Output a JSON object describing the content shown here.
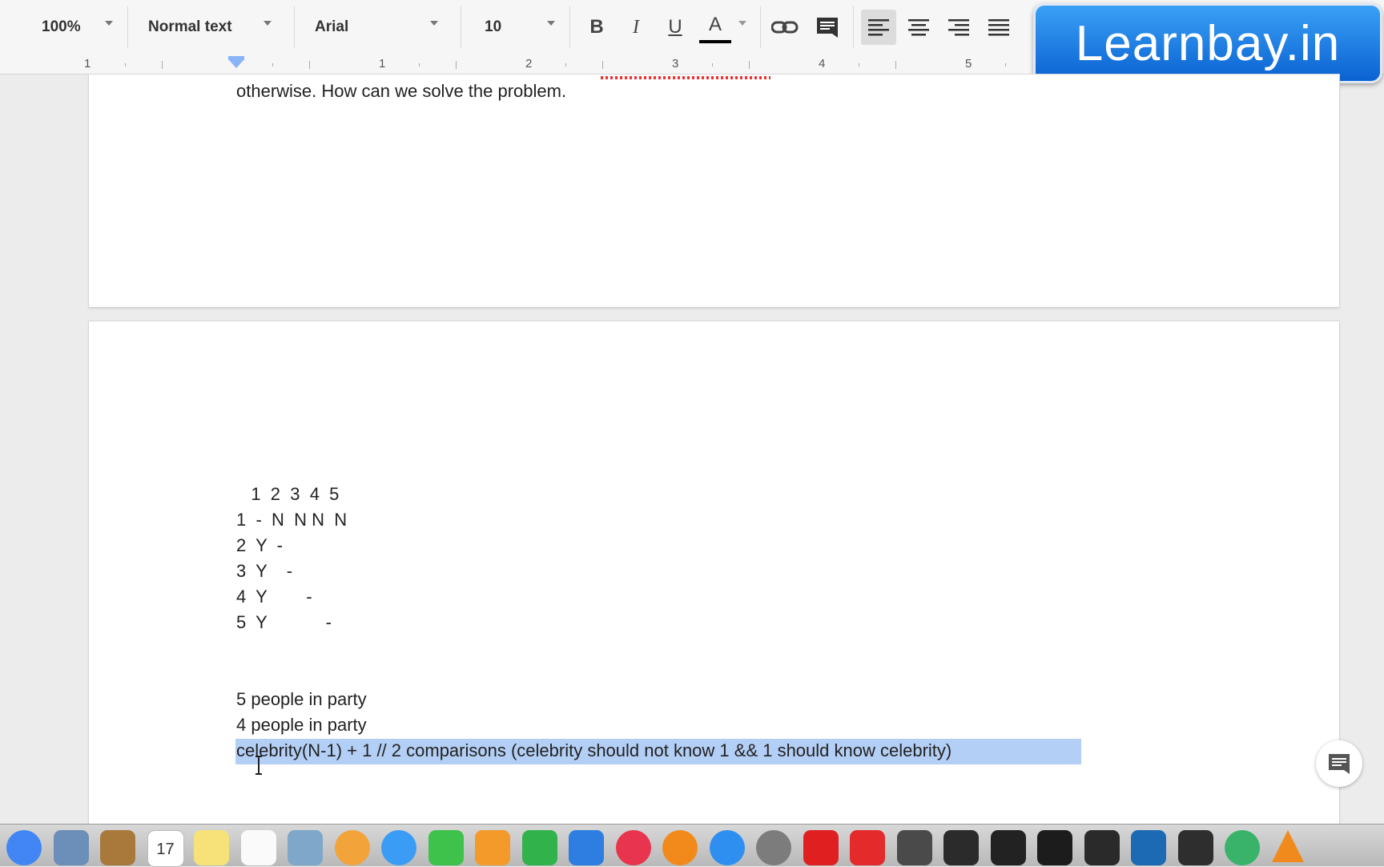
{
  "toolbar": {
    "zoom": "100%",
    "style": "Normal text",
    "font": "Arial",
    "size": "10",
    "bold": "B",
    "italic": "I",
    "underline": "U",
    "text_color": "A"
  },
  "ruler": {
    "labels": [
      "1",
      "1",
      "2",
      "3",
      "4",
      "5"
    ]
  },
  "logo": {
    "text": "Learnbay.in"
  },
  "page1": {
    "line": "otherwise. How can we solve the problem."
  },
  "page2": {
    "matrix": [
      "   1  2  3  4  5",
      "1  -  N  N N  N",
      "2  Y  -",
      "3  Y    -",
      "4  Y        -",
      "5  Y            -"
    ],
    "notes": [
      "5 people in party",
      "4 people in party",
      "celebrity(N-1) + 1 // 2 comparisons (celebrity should not know 1 && 1 should know celebrity)"
    ]
  },
  "dock": {
    "apps": [
      "chrome-icon",
      "mail-icon",
      "contacts-icon",
      "calendar-icon",
      "notes-icon",
      "reminders-icon",
      "preview-icon",
      "photos-icon",
      "messages-icon",
      "facetime-icon",
      "pages-icon",
      "numbers-icon",
      "keynote-icon",
      "itunes-icon",
      "ibooks-icon",
      "app-store-icon",
      "system-preferences-icon",
      "airtel-icon",
      "airtel-red-icon",
      "sublime-icon",
      "acrobat-icon",
      "activity-monitor-icon",
      "terminal-icon",
      "console-icon",
      "virtualbox-icon",
      "blank-app-icon",
      "globe-app-icon",
      "vlc-icon"
    ],
    "calendar_day": "17",
    "colors": {
      "chrome-icon": "#4285f4",
      "mail-icon": "#6b8fb8",
      "contacts-icon": "#a9793c",
      "calendar-icon": "#ffffff",
      "notes-icon": "#f7e27a",
      "reminders-icon": "#fafafa",
      "preview-icon": "#7fa7c9",
      "photos-icon": "#f2a33a",
      "messages-icon": "#3b9cf5",
      "facetime-icon": "#3ec24b",
      "pages-icon": "#f39a2b",
      "numbers-icon": "#32b24a",
      "keynote-icon": "#2d7ee0",
      "itunes-icon": "#e8344e",
      "ibooks-icon": "#f28a1b",
      "app-store-icon": "#2f8ff0",
      "system-preferences-icon": "#7c7c7c",
      "airtel-icon": "#e02020",
      "airtel-red-icon": "#e42a2a",
      "sublime-icon": "#4a4a4a",
      "acrobat-icon": "#2b2b2b",
      "activity-monitor-icon": "#222222",
      "terminal-icon": "#1c1c1c",
      "console-icon": "#2a2a2a",
      "virtualbox-icon": "#1c6ab4",
      "blank-app-icon": "#2e2e2e",
      "globe-app-icon": "#39b36a",
      "vlc-icon": "#f08a1c"
    }
  }
}
